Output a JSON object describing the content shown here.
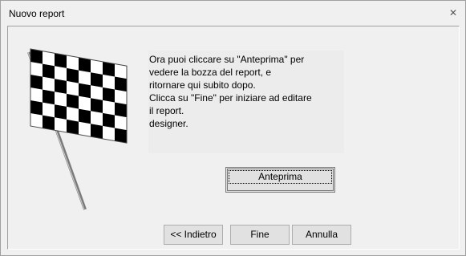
{
  "window": {
    "title": "Nuovo report",
    "close_icon": "close-icon"
  },
  "message": {
    "lines": [
      "Ora puoi cliccare su \"Anteprima\" per",
      "vedere la bozza del report, e",
      "ritornare qui subito dopo.",
      "Clicca su \"Fine\" per iniziare ad editare",
      "il report.",
      "designer."
    ]
  },
  "buttons": {
    "preview": "Anteprima",
    "back": "<< Indietro",
    "finish": "Fine",
    "cancel": "Annulla"
  },
  "illustration": "checkered-flag-icon"
}
